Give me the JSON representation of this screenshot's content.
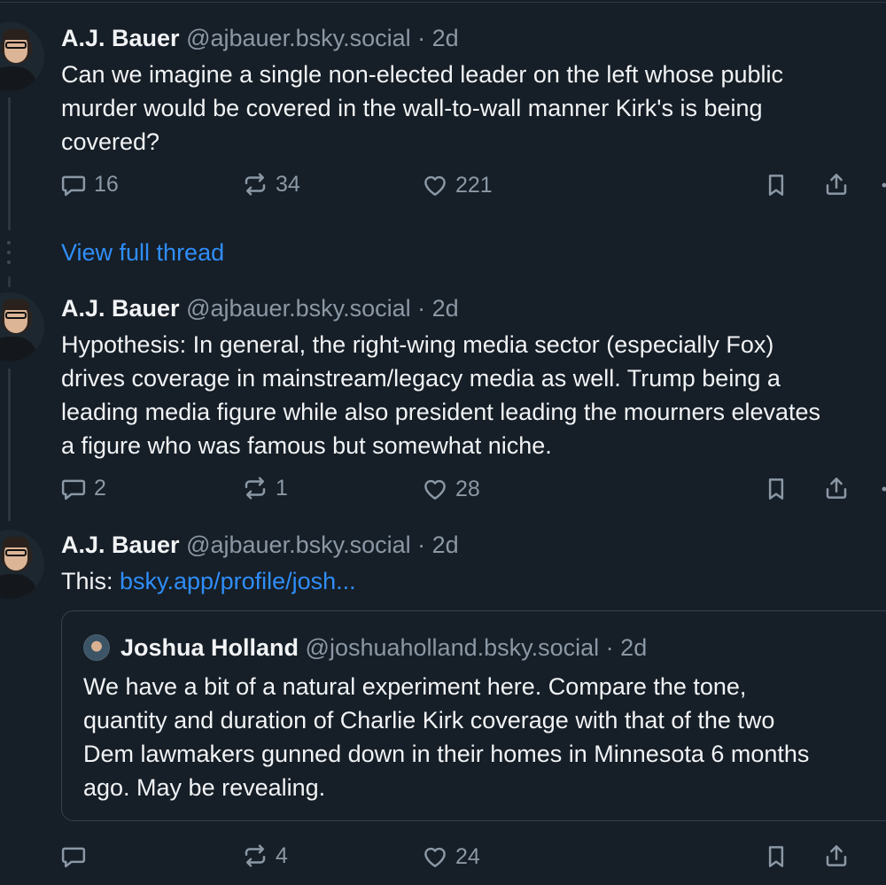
{
  "colors": {
    "background": "#161e27",
    "text": "#f1f3f5",
    "muted": "#8b98a5",
    "link": "#2f8ef9",
    "border": "#34414d"
  },
  "posts": [
    {
      "author": "A.J. Bauer",
      "handle": "@ajbauer.bsky.social",
      "separator": "·",
      "age": "2d",
      "text_lines": [
        "Can we imagine a single non-elected leader on the left whose public",
        "murder would be covered in the wall-to-wall manner Kirk's is being",
        "covered?"
      ],
      "replies": "16",
      "reposts": "34",
      "likes": "221"
    },
    {
      "author": "A.J. Bauer",
      "handle": "@ajbauer.bsky.social",
      "separator": "·",
      "age": "2d",
      "text_lines": [
        "Hypothesis: In general, the right-wing media sector (especially Fox)",
        "drives coverage in mainstream/legacy media as well. Trump being a",
        "leading media figure while also president leading the mourners elevates",
        "a figure who was famous but somewhat niche."
      ],
      "replies": "2",
      "reposts": "1",
      "likes": "28"
    },
    {
      "author": "A.J. Bauer",
      "handle": "@ajbauer.bsky.social",
      "separator": "·",
      "age": "2d",
      "text_prefix": "This: ",
      "link_text": "bsky.app/profile/josh...",
      "replies": "",
      "reposts": "4",
      "likes": "24"
    }
  ],
  "thread": {
    "view_full_thread": "View full thread"
  },
  "quote": {
    "author": "Joshua Holland",
    "handle": "@joshuaholland.bsky.social",
    "separator": "·",
    "age": "2d",
    "text_lines": [
      "We have a bit of a natural experiment here. Compare the tone,",
      "quantity and duration of Charlie Kirk coverage with that of the two",
      "Dem lawmakers gunned down in their homes in Minnesota 6 months",
      "ago. May be revealing."
    ]
  },
  "icons": [
    "reply-icon",
    "repost-icon",
    "like-icon",
    "bookmark-icon",
    "share-icon",
    "more-icon"
  ]
}
